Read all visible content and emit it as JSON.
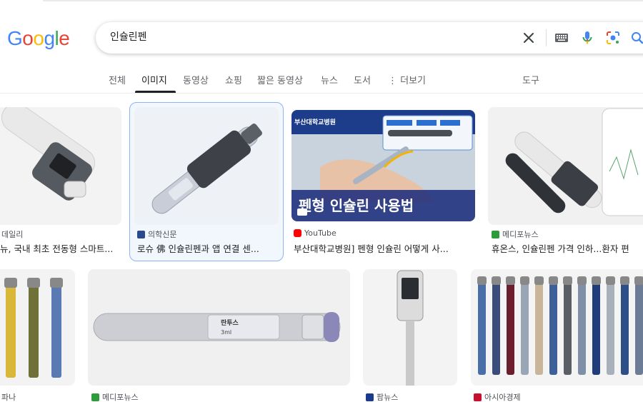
{
  "logo": [
    "G",
    "o",
    "o",
    "g",
    "l",
    "e"
  ],
  "search": {
    "query": "인슐린펜"
  },
  "tabs": [
    {
      "label": "전체"
    },
    {
      "label": "이미지"
    },
    {
      "label": "동영상"
    },
    {
      "label": "쇼핑"
    },
    {
      "label": "짧은 동영상"
    },
    {
      "label": "뉴스"
    },
    {
      "label": "도서"
    },
    {
      "label": "⋮ 더보기"
    },
    {
      "label": "도구"
    }
  ],
  "results": [
    {
      "source": "데일리",
      "caption": "뉴, 국내 최초 전동형 스마트..."
    },
    {
      "source": "의학신문",
      "caption": "로슈 佛 인슐린펜과 앱 연결 센..."
    },
    {
      "source": "YouTube",
      "caption": "부산대학교병원] 펜형 인슐린 어떻게 사...",
      "overlay_text": "펜형 인슐린 사용법",
      "brand": "부산대학교병원"
    },
    {
      "source": "메디포뉴스",
      "caption": "휴온스, 인슐린펜 가격 인하...환자 편"
    },
    {
      "source": "파나",
      "caption": ""
    },
    {
      "source": "메디포뉴스",
      "caption": "",
      "pen_label": "란투스",
      "pen_sub": "3ml"
    },
    {
      "source": "팜뉴스",
      "caption": ""
    },
    {
      "source": "아시아경제",
      "caption": ""
    }
  ],
  "colors": {
    "google_blue": "#4285f4",
    "google_red": "#ea4335",
    "google_yellow": "#fbbc05",
    "google_green": "#34a853",
    "selected_border": "#8ab4f8",
    "youtube_red": "#ff0000",
    "medipo_green": "#2e9b3a"
  }
}
